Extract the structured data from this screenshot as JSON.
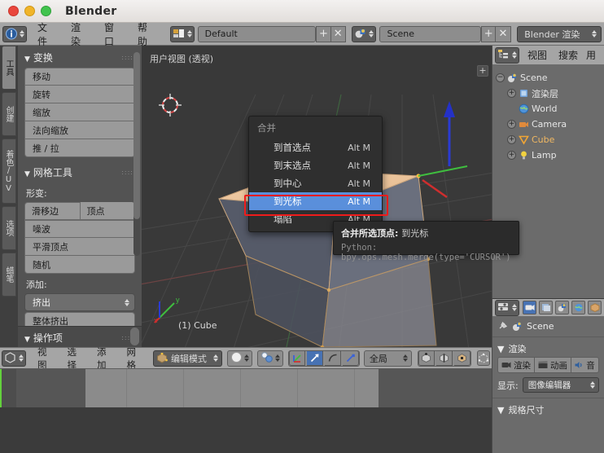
{
  "window": {
    "title": "Blender",
    "dots": [
      "close",
      "minimize",
      "maximize"
    ]
  },
  "topbar": {
    "editor_icon": "info-editor-icon",
    "menus": [
      "文件",
      "渲染",
      "窗口",
      "帮助"
    ],
    "screen_layout": {
      "icon": "screen-layout-icon",
      "value": "Default",
      "add": "+",
      "remove": "✕"
    },
    "scene": {
      "icon": "scene-icon",
      "value": "Scene",
      "add": "+",
      "remove": "✕"
    },
    "engine": {
      "value": "Blender 渲染"
    }
  },
  "toolshelf": {
    "tabs": [
      {
        "label": "工具",
        "active": true
      },
      {
        "label": "创建",
        "active": false
      },
      {
        "label": "着色/UV",
        "active": false
      },
      {
        "label": "选项",
        "active": false
      },
      {
        "label": "蜡笔",
        "active": false
      }
    ],
    "transform": {
      "title": "变换",
      "buttons": [
        "移动",
        "旋转",
        "缩放",
        "法向缩放",
        "推 / 拉"
      ]
    },
    "mesh_tools": {
      "title": "网格工具",
      "deform_label": "形变:",
      "deform_pair": [
        "滑移边",
        "顶点"
      ],
      "deform_buttons": [
        "噪波",
        "平滑顶点",
        "随机"
      ],
      "add_label": "添加:",
      "add_dropdown": "挤出",
      "add_buttons": [
        "整体挤出"
      ]
    },
    "operator_panel": {
      "title": "操作项"
    }
  },
  "viewport": {
    "view_label": "用户视图 (透视)",
    "object_label": "(1) Cube",
    "axis_gizmo": {
      "y": "y",
      "x": "x"
    },
    "plus_button": "+"
  },
  "viewport_header": {
    "editor_icon": "3d-view-editor-icon",
    "menus": [
      "视图",
      "选择",
      "添加",
      "网格"
    ],
    "mode": {
      "icon": "edit-mode-icon",
      "value": "编辑模式"
    },
    "shading": {
      "icon": "solid-shading-icon"
    },
    "pivot": {
      "icon": "pivot-median-icon"
    },
    "manipulators": [
      "translate-manipulator-icon",
      "rotate-manipulator-icon",
      "scale-manipulator-icon"
    ],
    "orientation": "全局",
    "select_modes": [
      "vertex-select-icon",
      "edge-select-icon",
      "face-select-icon"
    ],
    "occlude": "occlude-geometry-icon"
  },
  "merge_menu": {
    "title": "合并",
    "items": [
      {
        "label": "到首选点",
        "shortcut": "Alt M",
        "highlighted": false
      },
      {
        "label": "到末选点",
        "shortcut": "Alt M",
        "highlighted": false
      },
      {
        "label": "到中心",
        "shortcut": "Alt M",
        "highlighted": false
      },
      {
        "label": "到光标",
        "shortcut": "Alt M",
        "highlighted": true
      },
      {
        "label": "塌陷",
        "shortcut": "Alt M",
        "highlighted": false
      }
    ],
    "highlight_box_color": "#ef1b1b",
    "highlight_color": "#5a8fdb"
  },
  "tooltip": {
    "title": "合并所选顶点:",
    "title_value": "到光标",
    "python": "Python: bpy.ops.mesh.merge(type='CURSOR')"
  },
  "outliner": {
    "header": {
      "editor_icon": "outliner-editor-icon",
      "menus": [
        "视图",
        "搜索"
      ],
      "extra": "用"
    },
    "tree": [
      {
        "label": "Scene",
        "icon": "scene-icon",
        "depth": 0,
        "expander": "−",
        "selected": false
      },
      {
        "label": "渲染层",
        "icon": "renderlayer-icon",
        "depth": 1,
        "expander": "+",
        "selected": false
      },
      {
        "label": "World",
        "icon": "world-icon",
        "depth": 1,
        "expander": "",
        "selected": false
      },
      {
        "label": "Camera",
        "icon": "camera-icon",
        "depth": 1,
        "expander": "+",
        "selected": false
      },
      {
        "label": "Cube",
        "icon": "mesh-icon",
        "depth": 1,
        "expander": "+",
        "selected": true
      },
      {
        "label": "Lamp",
        "icon": "lamp-icon",
        "depth": 1,
        "expander": "+",
        "selected": false
      }
    ]
  },
  "properties": {
    "header_tabs": [
      "render-tab-icon",
      "renderlayer-tab-icon",
      "scene-tab-icon",
      "world-tab-icon",
      "object-tab-icon"
    ],
    "breadcrumb": {
      "pin": "pin-icon",
      "icon": "scene-icon",
      "label": "Scene"
    },
    "render_panel": {
      "title": "渲染",
      "buttons": [
        {
          "label": "渲染",
          "icon": "camera-icon"
        },
        {
          "label": "动画",
          "icon": "clapper-icon"
        },
        {
          "label": "音",
          "icon": "speaker-icon"
        }
      ],
      "display_label": "显示:",
      "display_value": "图像编辑器"
    },
    "dimensions_panel": {
      "title": "规格尺寸"
    }
  },
  "timeline": {
    "playhead_frame": 1,
    "accent": "#63d13c"
  }
}
